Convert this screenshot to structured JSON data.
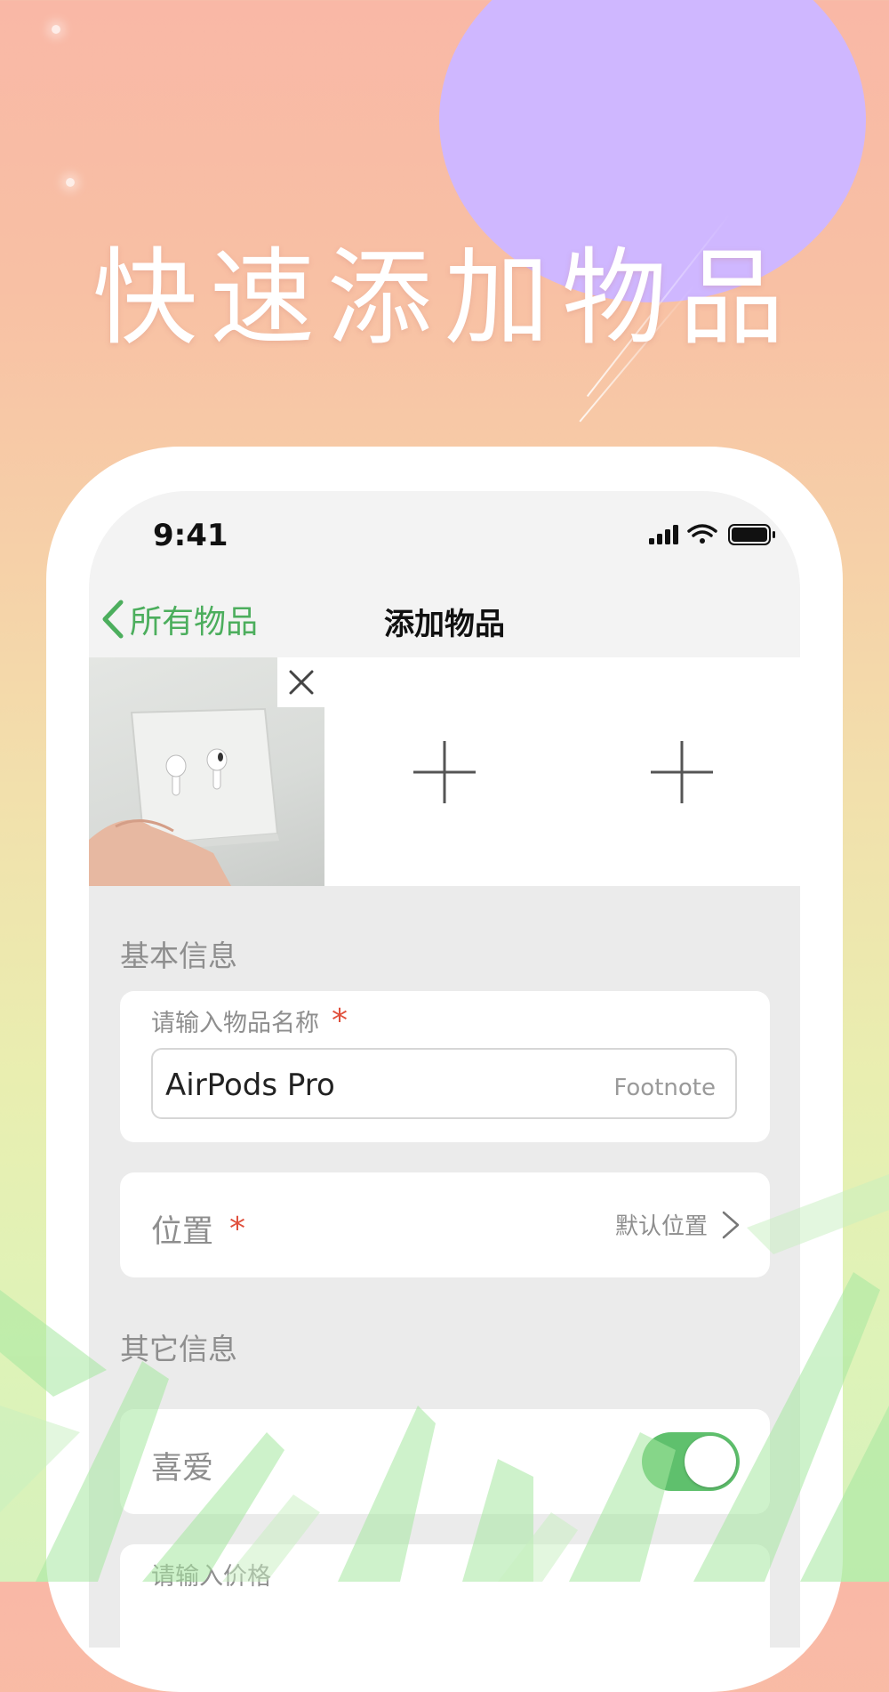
{
  "promo": {
    "headline": "快速添加物品"
  },
  "status_bar": {
    "time": "9:41",
    "icons": [
      "signal-icon",
      "wifi-icon",
      "battery-icon"
    ]
  },
  "nav": {
    "back_label": "所有物品",
    "title": "添加物品"
  },
  "photos": {
    "items": [
      {
        "type": "photo",
        "subject": "airpods-box-photo",
        "removable": true
      },
      {
        "type": "add-slot",
        "icon": "plus-icon"
      },
      {
        "type": "add-slot",
        "icon": "plus-icon"
      }
    ]
  },
  "basic_info": {
    "section_title": "基本信息",
    "name_field": {
      "label": "请输入物品名称",
      "required_mark": "*",
      "value": "AirPods Pro",
      "hint": "Footnote"
    },
    "location": {
      "label": "位置",
      "required_mark": "*",
      "value": "默认位置"
    }
  },
  "other_info": {
    "section_title": "其它信息",
    "favorite": {
      "label": "喜爱",
      "enabled": true
    },
    "price_field": {
      "label": "请输入价格"
    }
  },
  "colors": {
    "accent": "#4cae5d",
    "toggle_on": "#5fc06d",
    "required": "#e0503d",
    "moon": "#cfb7ff"
  }
}
